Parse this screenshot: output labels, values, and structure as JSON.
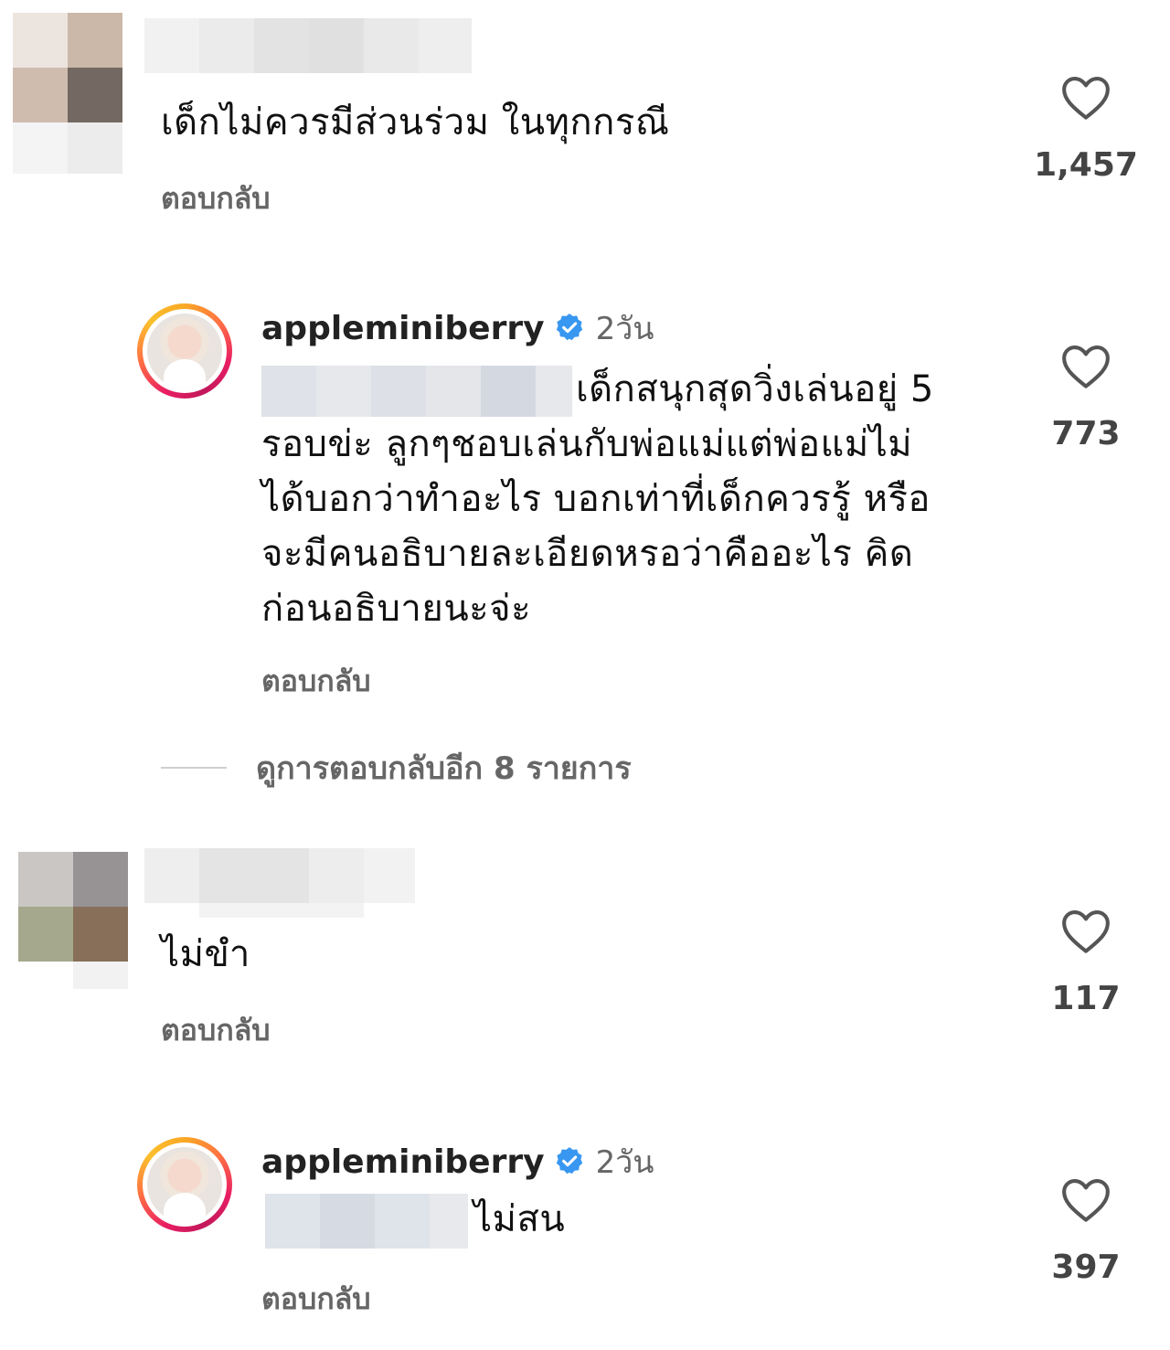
{
  "comments": [
    {
      "text": "เด็กไม่ควรมีส่วนร่วม ในทุกกรณี",
      "reply_label": "ตอบกลับ",
      "likes": "1,457",
      "reply": {
        "username": "appleminiberry",
        "time": "2วัน",
        "text_line1": "เด็กสนุกสุดวิ่งเล่นอยู่ 5",
        "text_rest": [
          "รอบข่ะ ลูกๆชอบเล่นกับพ่อแม่แต่พ่อแม่ไม่",
          "ได้บอกว่าทำอะไร บอกเท่าที่เด็กควรรู้ หรือ",
          "จะมีคนอธิบายละเอียดหรอว่าคืออะไร คิด",
          "ก่อนอธิบายนะจ่ะ"
        ],
        "reply_label": "ตอบกลับ",
        "likes": "773"
      },
      "view_more": "ดูการตอบกลับอีก 8 รายการ"
    },
    {
      "text": "ไม่ขำ",
      "reply_label": "ตอบกลับ",
      "likes": "117",
      "reply": {
        "username": "appleminiberry",
        "time": "2วัน",
        "text": "ไม่สน",
        "reply_label": "ตอบกลับ",
        "likes": "397"
      }
    }
  ],
  "icons": {
    "heart": "heart-icon",
    "verified": "verified-badge-icon",
    "verified_color": "#3897f0"
  }
}
